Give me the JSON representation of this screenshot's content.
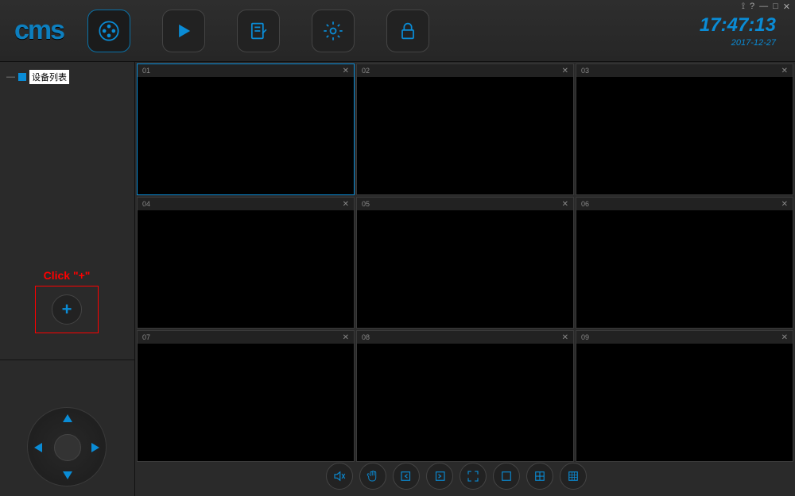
{
  "app": {
    "logo": "cms"
  },
  "clock": {
    "time": "17:47:13",
    "date": "2017-12-27"
  },
  "window_controls": {
    "pin": "⟟",
    "help": "?",
    "min": "—",
    "max": "□",
    "close": "✕"
  },
  "sidebar": {
    "tree_root": "设备列表",
    "annotation": "Click \"+\"",
    "add_label": "+"
  },
  "cells": [
    {
      "id": "01",
      "close": "✕",
      "selected": true
    },
    {
      "id": "02",
      "close": "✕",
      "selected": false
    },
    {
      "id": "03",
      "close": "✕",
      "selected": false
    },
    {
      "id": "04",
      "close": "✕",
      "selected": false
    },
    {
      "id": "05",
      "close": "✕",
      "selected": false
    },
    {
      "id": "06",
      "close": "✕",
      "selected": false
    },
    {
      "id": "07",
      "close": "✕",
      "selected": false
    },
    {
      "id": "08",
      "close": "✕",
      "selected": false
    },
    {
      "id": "09",
      "close": "✕",
      "selected": false
    }
  ]
}
